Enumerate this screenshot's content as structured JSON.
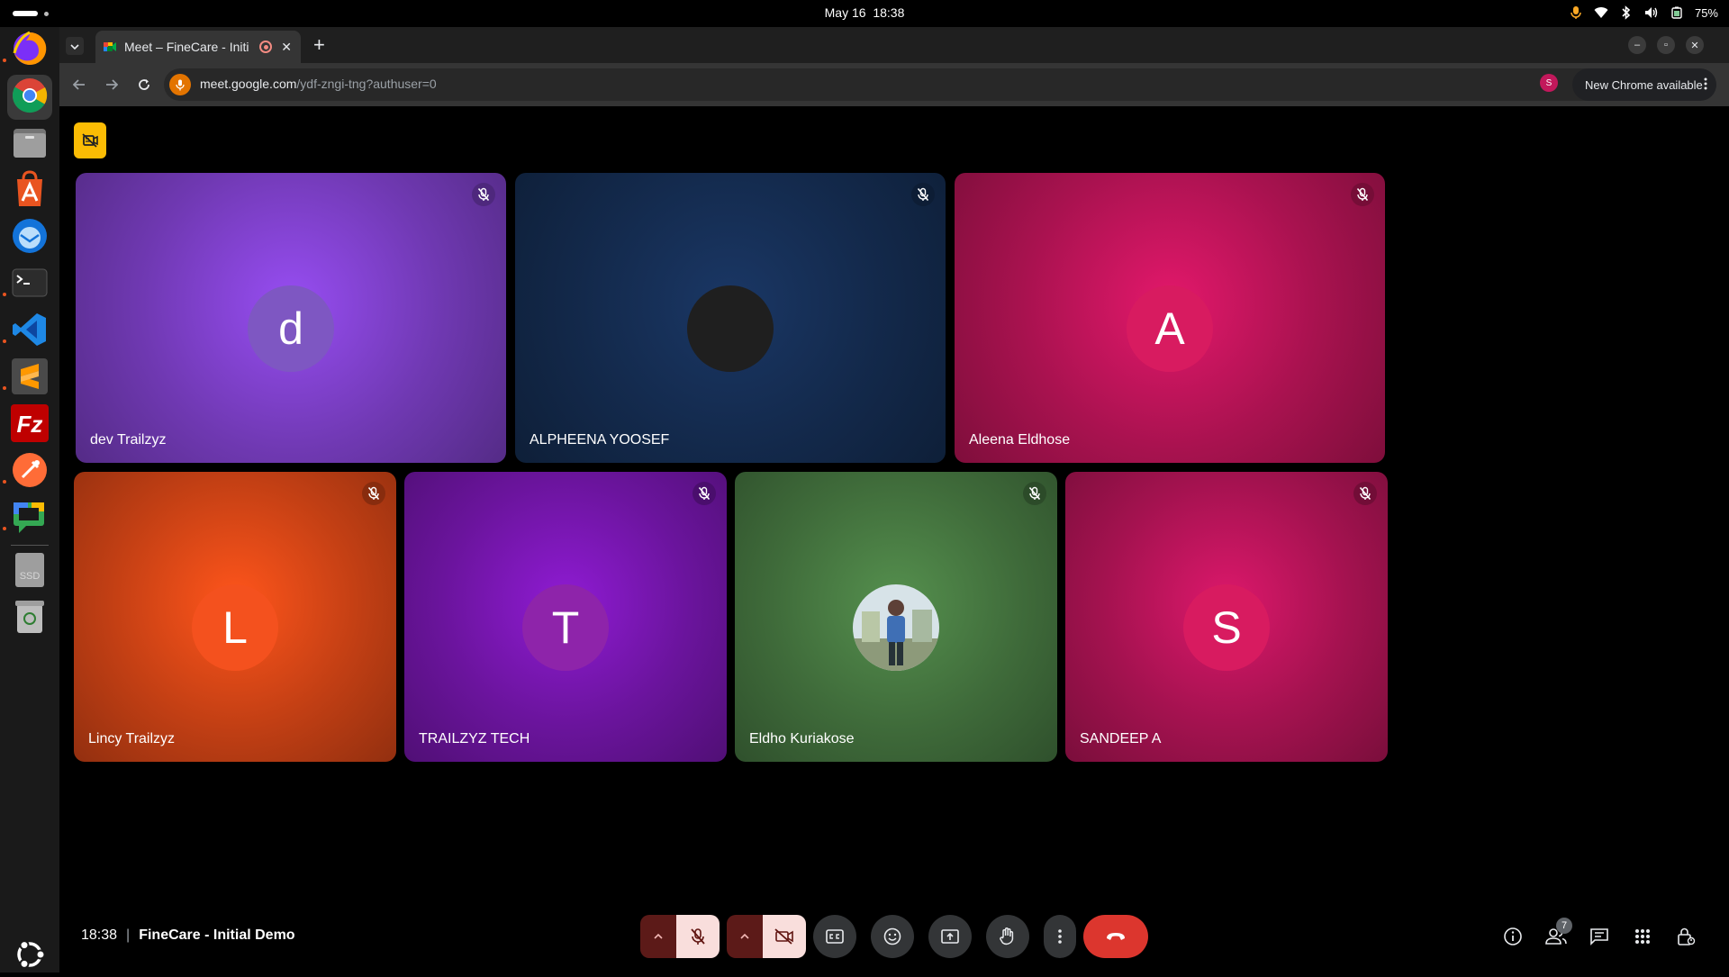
{
  "system": {
    "date": "May 16",
    "time": "18:38",
    "battery": "75%"
  },
  "browser": {
    "tab_title": "Meet – FineCare - Initi",
    "url_host": "meet.google.com",
    "url_path": "/ydf-zngi-tng?authuser=0",
    "profile_initial": "S",
    "update_label": "New Chrome available"
  },
  "meeting": {
    "time": "18:38",
    "separator": "|",
    "title": "FineCare - Initial Demo",
    "people_count": "7"
  },
  "participants": [
    {
      "name": "dev Trailzyz",
      "initial": "d",
      "avatar_color": "#7e57c2",
      "tile_color": "#7039b3"
    },
    {
      "name": "ALPHEENA YOOSEF",
      "initial": "",
      "avatar_color": "#1f1f1f",
      "tile_color": "#13294b"
    },
    {
      "name": "Aleena Eldhose",
      "initial": "A",
      "avatar_color": "#d81b60",
      "tile_color": "#a8124f"
    },
    {
      "name": "Lincy Trailzyz",
      "initial": "L",
      "avatar_color": "#f4511e",
      "tile_color": "#c23f14"
    },
    {
      "name": "TRAILZYZ TECH",
      "initial": "T",
      "avatar_color": "#8e24aa",
      "tile_color": "#6a149c"
    },
    {
      "name": "Eldho Kuriakose",
      "initial": "",
      "avatar_color": "#cfd8dc",
      "tile_color": "#3f6b3a"
    },
    {
      "name": "SANDEEP A",
      "initial": "S",
      "avatar_color": "#d81b60",
      "tile_color": "#a3124f"
    }
  ],
  "colors": {
    "end_call": "#dc362e",
    "muted_ctrl_bg": "#f9dedc",
    "meet_badge": "#fbbc04"
  }
}
